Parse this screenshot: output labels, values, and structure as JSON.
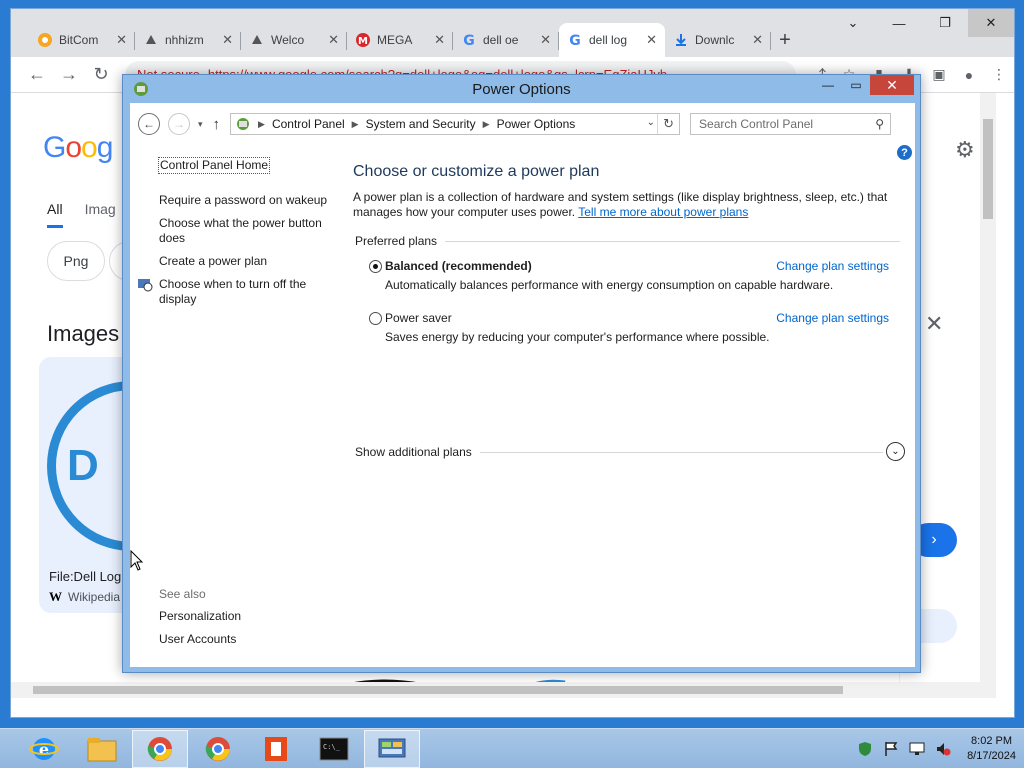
{
  "browser": {
    "tabs": [
      {
        "title": "BitCom",
        "icon": "bitcomet-icon"
      },
      {
        "title": "nhhizm",
        "icon": "page-icon"
      },
      {
        "title": "Welco",
        "icon": "page-icon"
      },
      {
        "title": "MEGA",
        "icon": "mega-icon"
      },
      {
        "title": "dell oe",
        "icon": "google-icon"
      },
      {
        "title": "dell log",
        "icon": "google-icon",
        "selected": true
      },
      {
        "title": "Downlc",
        "icon": "download-icon"
      }
    ],
    "new_tab": "+",
    "security": "Not secure",
    "url": "https://www.google.com/search?q=dell+logo&oq=dell+logo&gs_lcrp=EgZjaHJvb"
  },
  "google": {
    "logo": "Goog",
    "tabs": [
      "All",
      "Imag"
    ],
    "chip": "Png",
    "images_heading": "Images",
    "card_logo_text": "D",
    "card_caption": "File:Dell Log",
    "card_source": "Wikipedia",
    "card_source_icon": "W"
  },
  "window": {
    "title": "Power Options",
    "address": [
      "Control Panel",
      "System and Security",
      "Power Options"
    ],
    "search_placeholder": "Search Control Panel",
    "left_links": {
      "home": "Control Panel Home",
      "password": "Require a password on wakeup",
      "power_button": "Choose what the power button does",
      "create_plan": "Create a power plan",
      "display": "Choose when to turn off the display"
    },
    "see_also": {
      "heading": "See also",
      "personalization": "Personalization",
      "user_accounts": "User Accounts"
    },
    "heading": "Choose or customize a power plan",
    "description": "A power plan is a collection of hardware and system settings (like display brightness, sleep, etc.) that manages how your computer uses power.",
    "tell_me_more": "Tell me more about power plans",
    "preferred_label": "Preferred plans",
    "plans": [
      {
        "name": "Balanced (recommended)",
        "desc": "Automatically balances performance with energy consumption on capable hardware.",
        "selected": true,
        "link": "Change plan settings"
      },
      {
        "name": "Power saver",
        "desc": "Saves energy by reducing your computer's performance where possible.",
        "selected": false,
        "link": "Change plan settings"
      }
    ],
    "additional_label": "Show additional plans",
    "help": "?"
  },
  "taskbar": {
    "apps": [
      "internet-explorer-icon",
      "file-explorer-icon",
      "chrome-icon",
      "chrome-icon",
      "office-icon",
      "cmd-icon",
      "control-panel-icon"
    ],
    "time": "8:02 PM",
    "date": "8/17/2024"
  },
  "colors": {
    "accent": "#0066cc",
    "heading": "#1e395b",
    "window_frame": "#8ebbe8",
    "close": "#c7463b"
  }
}
